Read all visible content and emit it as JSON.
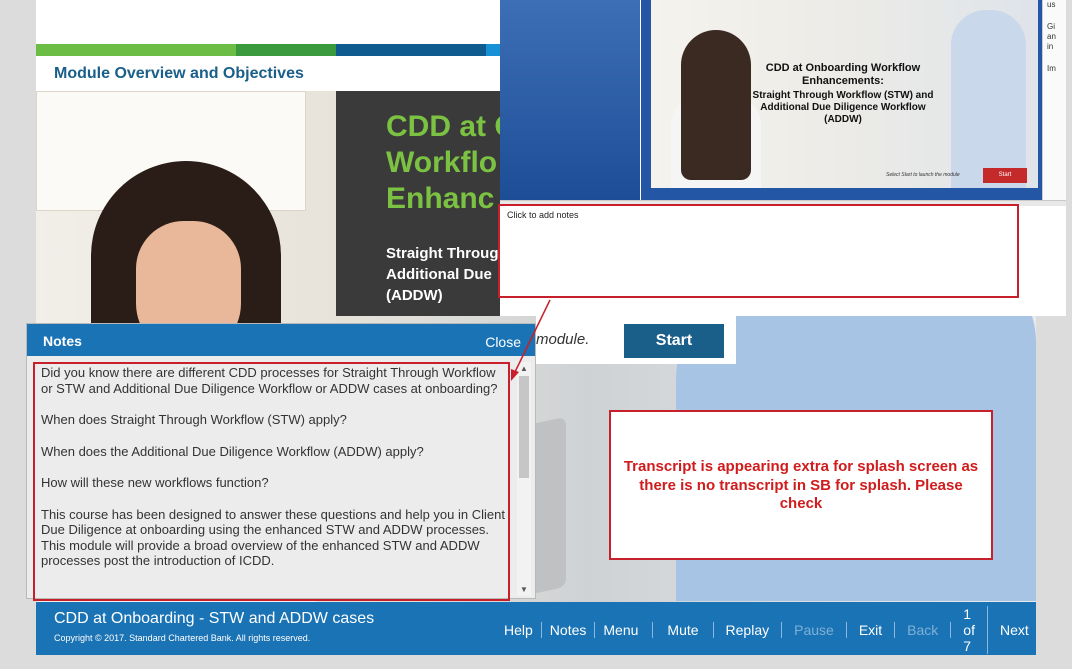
{
  "course": {
    "module_title": "Module Overview and Objectives",
    "title_box": {
      "big_title": "CDD at O\nWorkflo\nEnhanc",
      "subtitle": "Straight Throug\nAdditional Due\n(ADDW)"
    },
    "start_note": "module.",
    "start_label": "Start",
    "stripe_colors": [
      "#6bbd45",
      "#3a9a3d",
      "#0f5a8f",
      "#1790d6"
    ]
  },
  "footer": {
    "course_name": "CDD at Onboarding - STW and ADDW cases",
    "copyright": "Copyright © 2017. Standard Chartered Bank. All rights reserved.",
    "nav": {
      "help": "Help",
      "notes": "Notes",
      "menu": "Menu",
      "mute": "Mute",
      "replay": "Replay",
      "pause": "Pause",
      "exit": "Exit",
      "back": "Back",
      "page": "1 of 7",
      "next": "Next"
    }
  },
  "notes_panel": {
    "title": "Notes",
    "close": "Close",
    "paragraphs": [
      "Did you know there are different CDD processes for Straight Through Workflow or STW and Additional Due Diligence Workflow or ADDW cases at onboarding?",
      "When does Straight Through Workflow (STW) apply?",
      "When does the Additional Due Diligence Workflow (ADDW) apply?",
      "How will these new workflows function?",
      "This course has been designed to answer these questions and help you in Client Due Diligence at onboarding using the enhanced STW and ADDW processes. This module will provide a broad overview of the enhanced STW and ADDW processes post the introduction of ICDD."
    ]
  },
  "storyboard": {
    "slide_title": "CDD at Onboarding  Workflow\nEnhancements:",
    "slide_subtitle": "Straight Through Workflow (STW) and\nAdditional Due Diligence Workflow\n(ADDW)",
    "slide_hint": "Select Start to launch the module",
    "slide_start": "Start",
    "notes_placeholder": "Click to add notes",
    "right_snippets": [
      "us",
      "Gi\nan\nin",
      "Im"
    ]
  },
  "review": {
    "comment": "Transcript is appearing extra for splash screen as there is no transcript in SB for splash. Please check",
    "annotation_color": "#c8202a"
  },
  "colors": {
    "brand_blue": "#1a73b5",
    "title_green": "#7cc242",
    "dark_box": "#3a3a3a"
  }
}
